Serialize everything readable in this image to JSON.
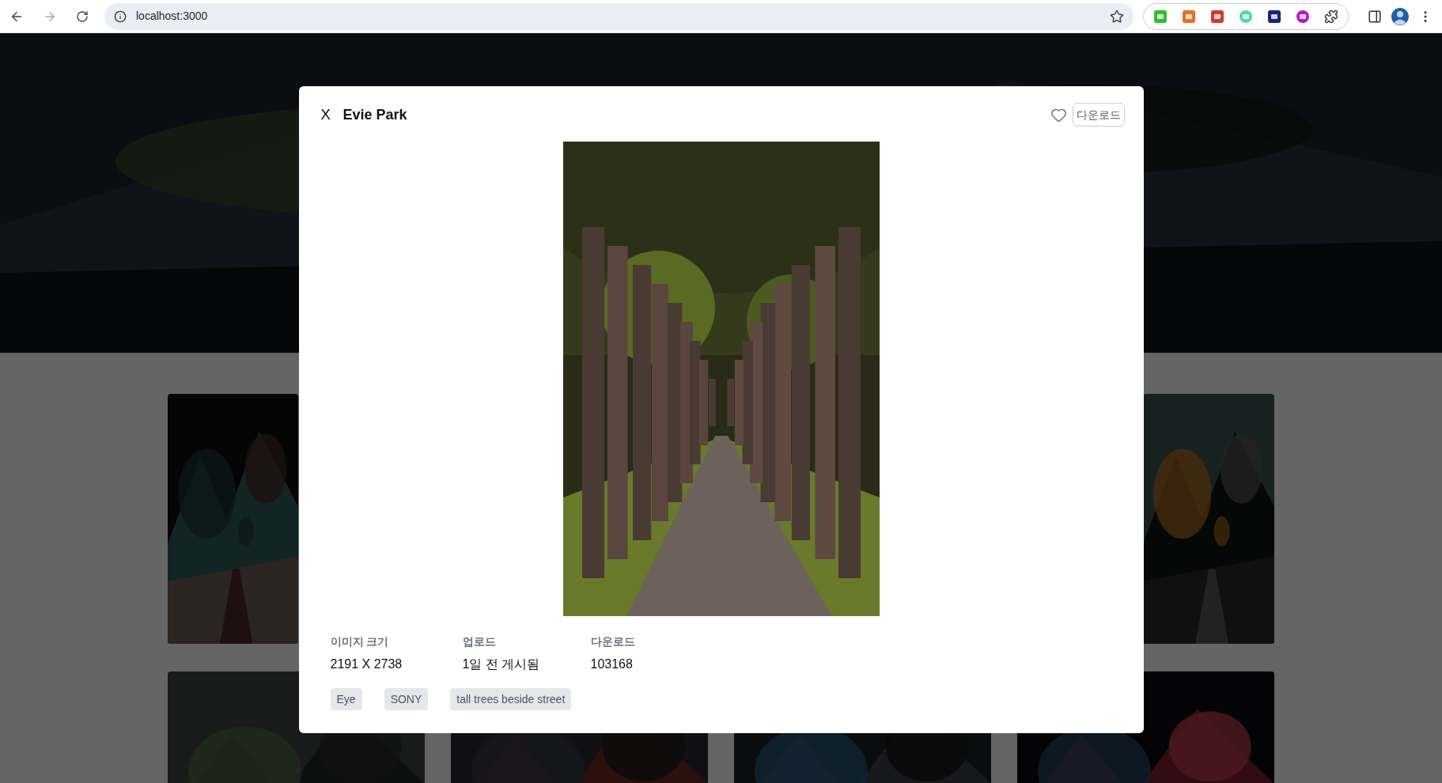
{
  "browser": {
    "url": "localhost:3000"
  },
  "modal": {
    "close_label": "X",
    "title": "Evie Park",
    "download_button": "다운로드",
    "info": [
      {
        "label": "이미지 크기",
        "value": "2191 X 2738"
      },
      {
        "label": "업로드",
        "value": "1일 전 게시됨"
      },
      {
        "label": "다운로드",
        "value": "103168"
      }
    ],
    "tags": [
      "Eye",
      "SONY",
      "tall trees beside street"
    ]
  }
}
